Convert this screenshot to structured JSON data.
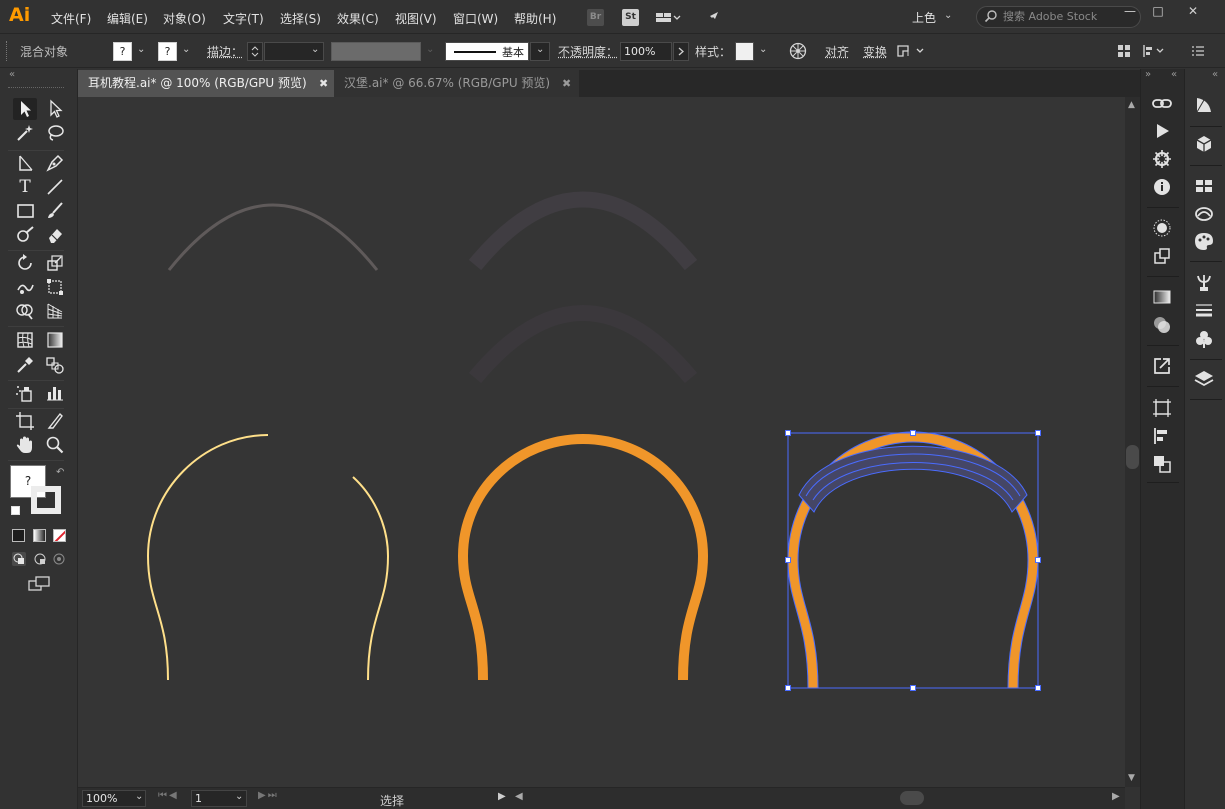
{
  "app": {
    "logo": "Ai"
  },
  "menu": [
    "文件(F)",
    "编辑(E)",
    "对象(O)",
    "文字(T)",
    "选择(S)",
    "效果(C)",
    "视图(V)",
    "窗口(W)",
    "帮助(H)"
  ],
  "bridge_badges": {
    "br": "Br",
    "st": "St"
  },
  "workspace": {
    "label": "上色"
  },
  "stock_search": {
    "placeholder": "搜索 Adobe Stock"
  },
  "window_controls": {
    "minimize": "—",
    "restore": "□",
    "close": "✕"
  },
  "control": {
    "selection_label": "混合对象",
    "fill_q": "?",
    "stroke_q": "?",
    "stroke_label": "描边：",
    "brush_label": "基本",
    "opacity_label": "不透明度：",
    "opacity_value": "100%",
    "style_label": "样式：",
    "align_label": "对齐",
    "transform_label": "变换"
  },
  "tabs": [
    {
      "label": "耳机教程.ai* @ 100% (RGB/GPU 预览)",
      "close": "✖",
      "active": true
    },
    {
      "label": "汉堡.ai* @ 66.67% (RGB/GPU 预览)",
      "close": "✖",
      "active": false
    }
  ],
  "fill_stroke": {
    "fill_q": "?"
  },
  "status": {
    "zoom": "100%",
    "artboard": "1",
    "tool": "选择"
  },
  "colors": {
    "accent": "#ff9a00",
    "orange_stroke": "#f0962a",
    "yellow_stroke": "#ffe08a",
    "selection_blue": "#4a6cff",
    "grey_arc": "#5f5a5a",
    "dark_arc": "#403d42",
    "canvas": "#353535"
  },
  "icons": {
    "toolbox": [
      "selection-tool-icon",
      "direct-selection-tool-icon",
      "magic-wand-icon",
      "lasso-icon",
      "line-tool-icon",
      "pen-tool-icon",
      "type-tool-icon",
      "line-segment-icon",
      "rectangle-tool-icon",
      "paintbrush-icon",
      "shaper-tool-icon",
      "eraser-icon",
      "rotate-tool-icon",
      "scale-tool-icon",
      "warp-tool-icon",
      "free-transform-icon",
      "shape-builder-icon",
      "perspective-grid-icon",
      "mesh-tool-icon",
      "gradient-tool-icon",
      "eyedropper-icon",
      "blend-tool-icon",
      "symbol-sprayer-icon",
      "graph-tool-icon",
      "artboard-tool-icon",
      "slice-tool-icon",
      "hand-tool-icon",
      "zoom-tool-icon"
    ],
    "panels": [
      "links-icon",
      "actions-icon",
      "properties-icon",
      "info-icon",
      "appearance-icon",
      "navigator-icon",
      "gradient-icon",
      "transparency-icon",
      "export-icon",
      "artboards-icon",
      "align-icon",
      "pathfinder-icon",
      "color-guide-icon",
      "libraries-icon",
      "swatches-icon",
      "brushes-icon",
      "color-palette-icon",
      "symbols-icon",
      "stroke-icon",
      "graphic-styles-icon",
      "layers-icon"
    ]
  }
}
